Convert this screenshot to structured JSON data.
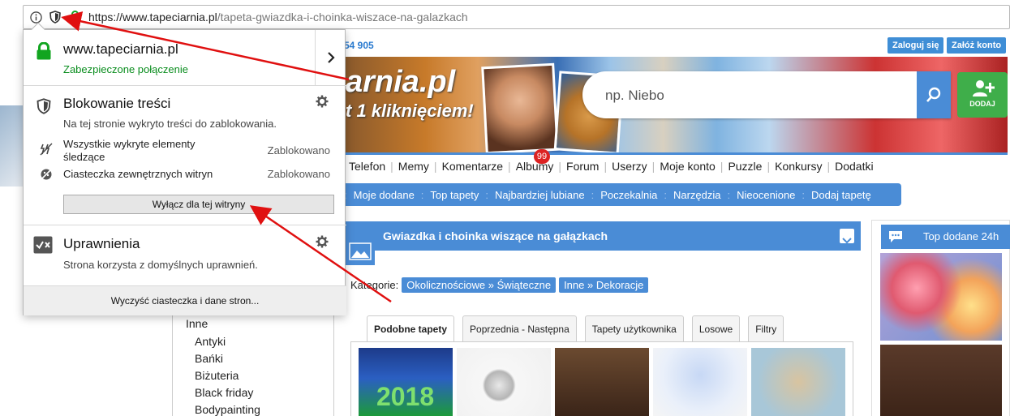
{
  "browser": {
    "url_host": "https://www.tapeciarnia.pl",
    "url_path": "/tapeta-gwiazdka-i-choinka-wiszace-na-galazkach"
  },
  "site": {
    "phone_fragment": "54 905",
    "login": "Zaloguj się",
    "register": "Załóż konto",
    "logo": "arnia.pl",
    "tagline": "t 1 kliknięciem!",
    "search_placeholder": "np. Niebo",
    "add_label": "DODAJ",
    "badge": "99",
    "nav": [
      "Telefon",
      "Memy",
      "Komentarze",
      "Albumy",
      "Forum",
      "Userzy",
      "Moje konto",
      "Puzzle",
      "Konkursy",
      "Dodatki"
    ],
    "subnav": [
      "Moje dodane",
      "Top tapety",
      "Najbardziej lubiane",
      "Poczekalnia",
      "Narzędzia",
      "Nieocenione",
      "Dodaj tapetę"
    ],
    "page_title": "Gwiazdka i choinka wiszące na gałązkach",
    "categories_label": "Kategorie:",
    "category1_a": "Okolicznościowe",
    "category1_b": "Świąteczne",
    "category2_a": "Inne",
    "category2_b": "Dekoracje",
    "crumb_sep": "»",
    "tabs": [
      "Podobne tapety",
      "Poprzednia - Następna",
      "Tapety użytkownika",
      "Losowe",
      "Filtry"
    ],
    "thumb1_text": "2018",
    "right_title": "Top dodane 24h",
    "left_heading": "Inne",
    "left_items": [
      "Antyki",
      "Bańki",
      "Biżuteria",
      "Black friday",
      "Bodypainting"
    ]
  },
  "popup": {
    "host": "www.tapeciarnia.pl",
    "secure": "Zabezpieczone połączenie",
    "blocking_title": "Blokowanie treści",
    "blocking_desc": "Na tej stronie wykryto treści do zablokowania.",
    "row1_label": "Wszystkie wykryte elementy śledzące",
    "row1_value": "Zablokowano",
    "row2_label": "Ciasteczka zewnętrznych witryn",
    "row2_value": "Zablokowano",
    "disable_button": "Wyłącz dla tej witryny",
    "perm_title": "Uprawnienia",
    "perm_desc": "Strona korzysta z domyślnych uprawnień.",
    "clear_button": "Wyczyść ciasteczka i dane stron..."
  },
  "colors": {
    "accent_blue": "#4a8cd6",
    "secure_green": "#0a8d1e",
    "annotation_red": "#e01010"
  }
}
